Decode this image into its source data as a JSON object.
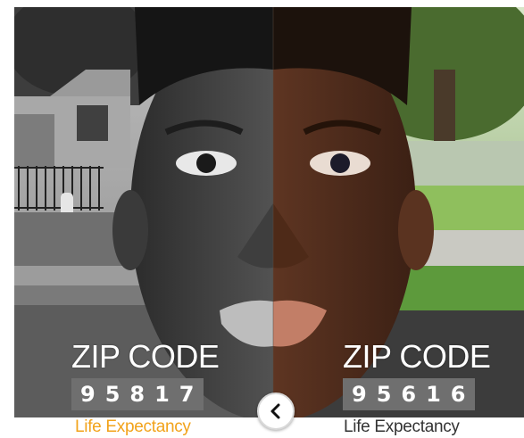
{
  "left": {
    "zip_label": "ZIP CODE",
    "zip_code": "95817",
    "caption": "Life Expectancy",
    "caption_color": "#f2a31b"
  },
  "right": {
    "zip_label": "ZIP CODE",
    "zip_code": "95616",
    "caption": "Life Expectancy",
    "caption_color": "#333333"
  },
  "controls": {
    "back_icon": "chevron-left-icon"
  }
}
